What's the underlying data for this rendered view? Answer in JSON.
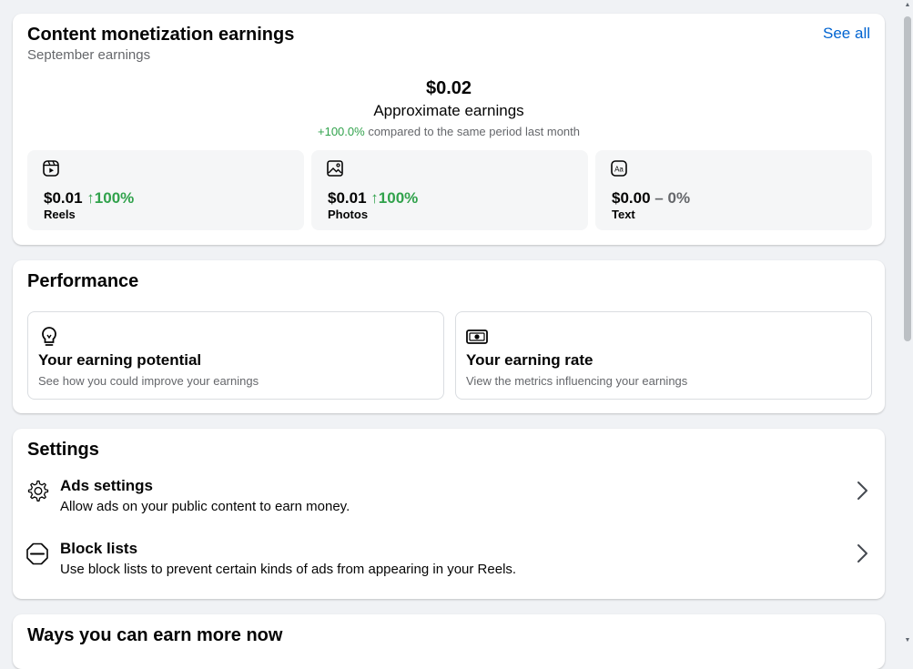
{
  "earnings": {
    "title": "Content monetization earnings",
    "subtitle": "September earnings",
    "see_all": "See all",
    "amount": "$0.02",
    "amount_label": "Approximate earnings",
    "compare_change": "+100.0%",
    "compare_text": "compared to the same period last month",
    "tiles": [
      {
        "icon": "reels-icon",
        "value": "$0.01",
        "arrow": "↑",
        "change": "100%",
        "trend": "up",
        "label": "Reels"
      },
      {
        "icon": "photo-icon",
        "value": "$0.01",
        "arrow": "↑",
        "change": "100%",
        "trend": "up",
        "label": "Photos"
      },
      {
        "icon": "text-icon",
        "value": "$0.00",
        "arrow": "–",
        "change": "0%",
        "trend": "flat",
        "label": "Text"
      }
    ]
  },
  "performance": {
    "title": "Performance",
    "items": [
      {
        "icon": "lightbulb-icon",
        "title": "Your earning potential",
        "desc": "See how you could improve your earnings"
      },
      {
        "icon": "money-icon",
        "title": "Your earning rate",
        "desc": "View the metrics influencing your earnings"
      }
    ]
  },
  "settings": {
    "title": "Settings",
    "items": [
      {
        "icon": "gear-icon",
        "title": "Ads settings",
        "desc": "Allow ads on your public content to earn money."
      },
      {
        "icon": "block-icon",
        "title": "Block lists",
        "desc": "Use block lists to prevent certain kinds of ads from appearing in your Reels."
      }
    ]
  },
  "ways": {
    "title": "Ways you can earn more now"
  },
  "colors": {
    "positive": "#31a24c",
    "link": "#0064d1",
    "secondary": "#65676b",
    "background": "#f0f2f5"
  }
}
